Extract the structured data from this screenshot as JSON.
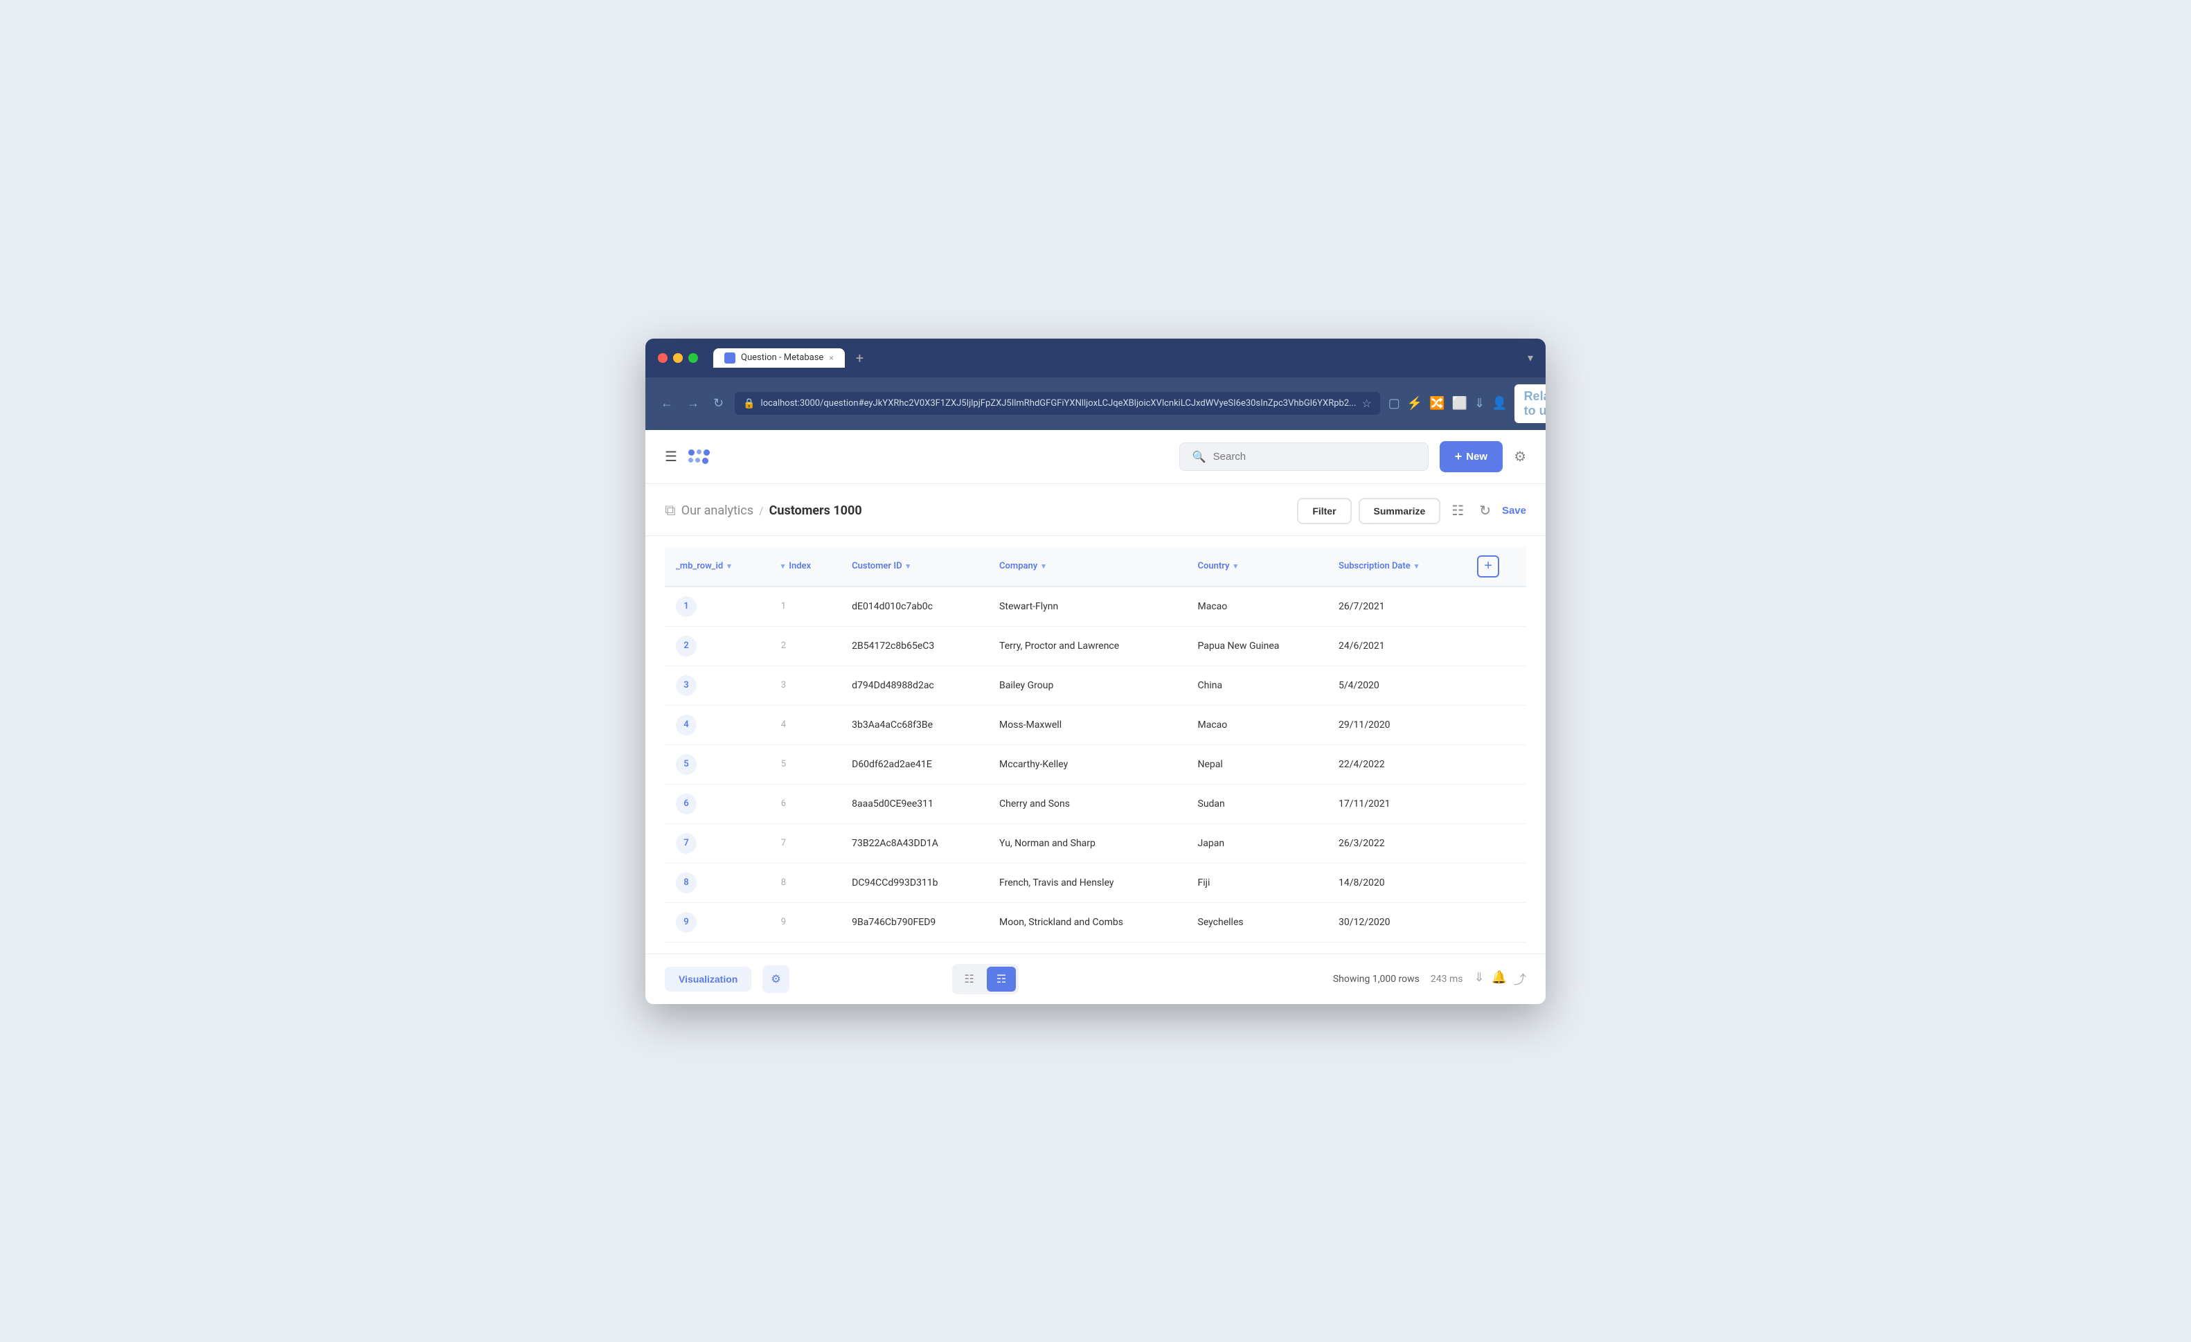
{
  "window": {
    "title": "Question - Metabase",
    "tab_close": "×",
    "tab_new": "+",
    "url": "localhost:3000/question#eyJkYXRhc2V0X3F1ZXJ5IjlpjFpZXJ5IlmRhdGFGFiYXNlljoxLCJqeXBljoicXVlcnkiLCJxdWVyeSI6e30sInZpc3VhbGl6YXRpb2..."
  },
  "browser": {
    "relaunch_label": "Relaunch to update"
  },
  "topnav": {
    "search_placeholder": "Search",
    "search_value": "",
    "new_button": "New"
  },
  "page": {
    "breadcrumb_section": "Our analytics",
    "separator": "/",
    "title": "Customers 1000",
    "filter_btn": "Filter",
    "summarize_btn": "Summarize",
    "save_btn": "Save"
  },
  "table": {
    "columns": [
      {
        "id": "mb_row_id",
        "label": "_mb_row_id",
        "has_chevron": true
      },
      {
        "id": "index",
        "label": "Index",
        "has_chevron": true
      },
      {
        "id": "customer_id",
        "label": "Customer ID",
        "has_chevron": true
      },
      {
        "id": "company",
        "label": "Company",
        "has_chevron": true
      },
      {
        "id": "country",
        "label": "Country",
        "has_chevron": true
      },
      {
        "id": "subscription_date",
        "label": "Subscription Date",
        "has_chevron": true
      }
    ],
    "rows": [
      {
        "badge": "1",
        "idx": "1",
        "customer_id": "dE014d010c7ab0c",
        "company": "Stewart-Flynn",
        "country": "Macao",
        "subscription_date": "26/7/2021"
      },
      {
        "badge": "2",
        "idx": "2",
        "customer_id": "2B54172c8b65eC3",
        "company": "Terry, Proctor and Lawrence",
        "country": "Papua New Guinea",
        "subscription_date": "24/6/2021"
      },
      {
        "badge": "3",
        "idx": "3",
        "customer_id": "d794Dd48988d2ac",
        "company": "Bailey Group",
        "country": "China",
        "subscription_date": "5/4/2020"
      },
      {
        "badge": "4",
        "idx": "4",
        "customer_id": "3b3Aa4aCc68f3Be",
        "company": "Moss-Maxwell",
        "country": "Macao",
        "subscription_date": "29/11/2020"
      },
      {
        "badge": "5",
        "idx": "5",
        "customer_id": "D60df62ad2ae41E",
        "company": "Mccarthy-Kelley",
        "country": "Nepal",
        "subscription_date": "22/4/2022"
      },
      {
        "badge": "6",
        "idx": "6",
        "customer_id": "8aaa5d0CE9ee311",
        "company": "Cherry and Sons",
        "country": "Sudan",
        "subscription_date": "17/11/2021"
      },
      {
        "badge": "7",
        "idx": "7",
        "customer_id": "73B22Ac8A43DD1A",
        "company": "Yu, Norman and Sharp",
        "country": "Japan",
        "subscription_date": "26/3/2022"
      },
      {
        "badge": "8",
        "idx": "8",
        "customer_id": "DC94CCd993D311b",
        "company": "French, Travis and Hensley",
        "country": "Fiji",
        "subscription_date": "14/8/2020"
      },
      {
        "badge": "9",
        "idx": "9",
        "customer_id": "9Ba746Cb790FED9",
        "company": "Moon, Strickland and Combs",
        "country": "Seychelles",
        "subscription_date": "30/12/2020"
      }
    ]
  },
  "bottombar": {
    "viz_label": "Visualization",
    "rows_label": "Showing 1,000 rows",
    "timing": "243 ms"
  },
  "colors": {
    "accent": "#5b7be9",
    "titlebar_bg": "#2c3e6b",
    "addressbar_bg": "#3a4f7a"
  }
}
